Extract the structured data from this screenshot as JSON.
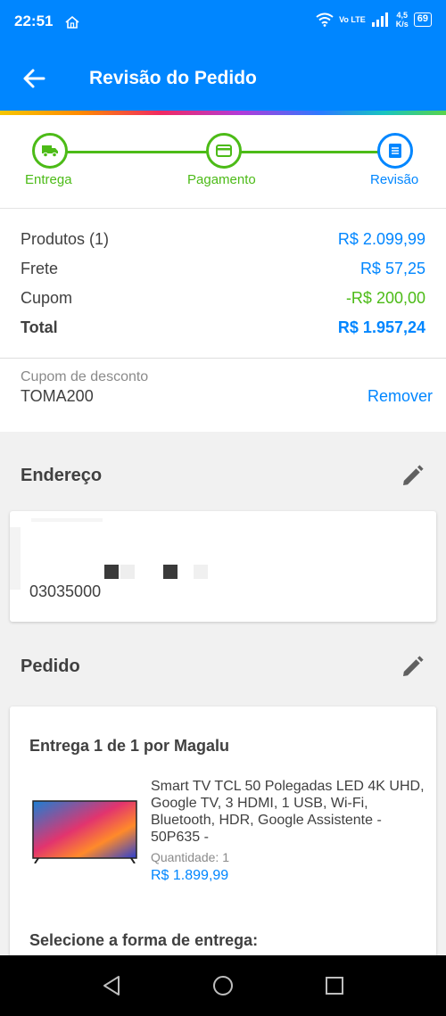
{
  "status_bar": {
    "time": "22:51",
    "network": "Vo LTE",
    "speed_value": "4,5",
    "speed_unit": "K/s",
    "battery": "69"
  },
  "app_bar": {
    "title": "Revisão do Pedido"
  },
  "stepper": {
    "steps": [
      {
        "label": "Entrega",
        "icon": "truck-icon"
      },
      {
        "label": "Pagamento",
        "icon": "card-icon"
      },
      {
        "label": "Revisão",
        "icon": "document-icon"
      }
    ],
    "colors": {
      "done": "#4cbb17",
      "current": "#0086ff"
    }
  },
  "summary": {
    "rows": [
      {
        "label": "Produtos (1)",
        "value": "R$ 2.099,99"
      },
      {
        "label": "Frete",
        "value": "R$ 57,25"
      },
      {
        "label": "Cupom",
        "value": "-R$ 200,00"
      },
      {
        "label": "Total",
        "value": "R$ 1.957,24"
      }
    ]
  },
  "coupon": {
    "placeholder": "Cupom de desconto",
    "value": "TOMA200",
    "remove_label": "Remover"
  },
  "address": {
    "title": "Endereço",
    "cep": "03035000"
  },
  "order": {
    "title": "Pedido",
    "shipment": "Entrega 1 de 1 por Magalu",
    "product_name": "Smart TV TCL 50 Polegadas LED 4K UHD, Google TV, 3 HDMI, 1 USB, Wi-Fi, Bluetooth, HDR, Google Assistente - 50P635 -",
    "quantity_label": "Quantidade:",
    "quantity": "1",
    "price": "R$ 1.899,99",
    "delivery_prompt": "Selecione a forma de entrega:"
  },
  "colors": {
    "brand": "#0086ff",
    "success": "#4cbb17"
  }
}
